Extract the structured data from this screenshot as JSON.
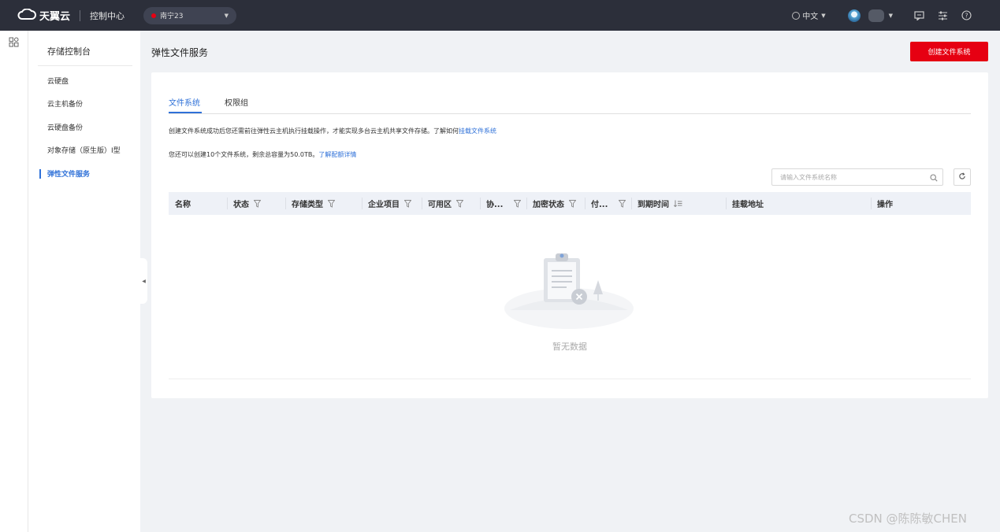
{
  "topbar": {
    "brand": "天翼云",
    "console": "控制中心",
    "region": "南宁23",
    "language": "中文"
  },
  "sidebar": {
    "title": "存储控制台",
    "items": [
      {
        "label": "云硬盘"
      },
      {
        "label": "云主机备份"
      },
      {
        "label": "云硬盘备份"
      },
      {
        "label": "对象存储（原生版）Ⅰ型"
      },
      {
        "label": "弹性文件服务"
      }
    ]
  },
  "header": {
    "title": "弹性文件服务",
    "create_button": "创建文件系统"
  },
  "tabs": [
    {
      "label": "文件系统",
      "active": true
    },
    {
      "label": "权限组",
      "active": false
    }
  ],
  "tips": {
    "line1_text": "创建文件系统成功后您还需前往弹性云主机执行挂载操作，才能实现多台云主机共享文件存储。了解如何",
    "line1_link": "挂载文件系统",
    "line2_text": "您还可以创建10个文件系统，剩余总容量为50.0TB。",
    "line2_link": "了解配额详情"
  },
  "search": {
    "placeholder": "请输入文件系统名称"
  },
  "table": {
    "columns": [
      {
        "label": "名称",
        "icon": ""
      },
      {
        "label": "状态",
        "icon": "filter-icon"
      },
      {
        "label": "存储类型",
        "icon": "filter-icon"
      },
      {
        "label": "企业项目",
        "icon": "filter-icon"
      },
      {
        "label": "可用区",
        "icon": "filter-icon"
      },
      {
        "label": "协...",
        "icon": "filter-icon"
      },
      {
        "label": "加密状态",
        "icon": "filter-icon"
      },
      {
        "label": "付...",
        "icon": "filter-icon"
      },
      {
        "label": "到期时间",
        "icon": "sort-icon"
      },
      {
        "label": "挂载地址",
        "icon": ""
      },
      {
        "label": "操作",
        "icon": ""
      }
    ],
    "rows": [],
    "empty_text": "暂无数据"
  },
  "watermark": "CSDN @陈陈敏CHEN",
  "colors": {
    "topbar": "#2c2f3a",
    "accent": "#2f71d8",
    "primary_button": "#e60012",
    "background": "#f0f2f5"
  }
}
